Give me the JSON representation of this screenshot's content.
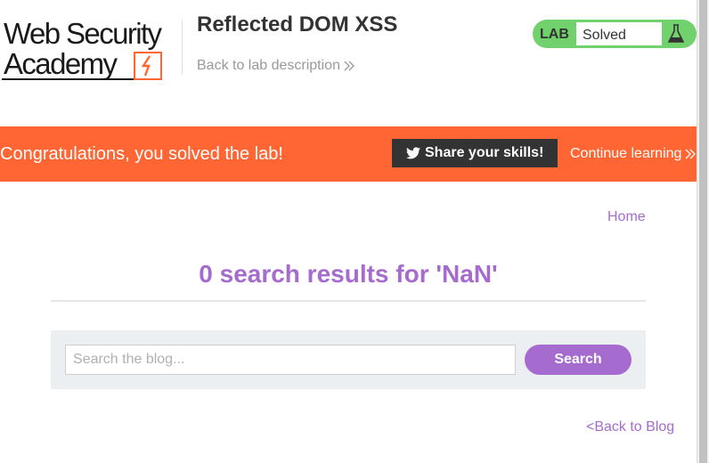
{
  "header": {
    "logo": {
      "line1": "Web Security",
      "line2": "Academy"
    },
    "lab_title": "Reflected DOM XSS",
    "back_link": "Back to lab description",
    "lab_status": {
      "label": "LAB",
      "status": "Solved"
    }
  },
  "banner": {
    "message": "Congratulations, you solved the lab!",
    "share_button": "Share your skills!",
    "continue_link": "Continue learning"
  },
  "nav": {
    "home": "Home"
  },
  "main": {
    "results_heading": "0 search results for 'NaN'",
    "search": {
      "placeholder": "Search the blog...",
      "value": "",
      "button": "Search"
    },
    "back_to_blog": "<Back to Blog"
  },
  "colors": {
    "accent": "#a56bcf",
    "banner": "#ff6633",
    "lab_status": "#70d16d",
    "share_button": "#333333"
  }
}
